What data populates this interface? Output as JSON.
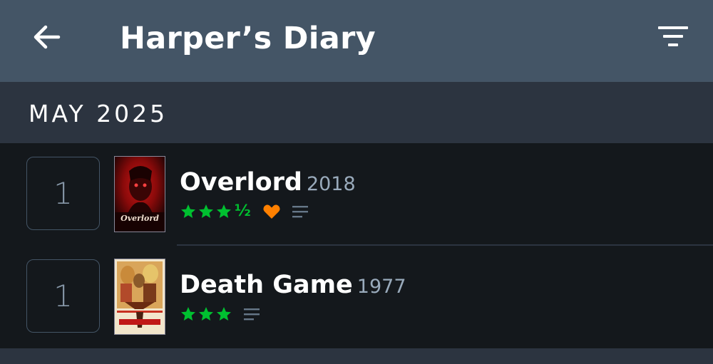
{
  "header": {
    "title": "Harper’s Diary",
    "back_icon": "arrow-left-icon",
    "filter_icon": "filter-icon"
  },
  "section": {
    "month": "MAY 2025"
  },
  "entries": [
    {
      "day": "1",
      "title": "Overlord",
      "year": "2018",
      "rating": 3.5,
      "rating_half": "½",
      "liked": true,
      "has_review": true,
      "poster_text": "Overlord"
    },
    {
      "day": "1",
      "title": "Death Game",
      "year": "1977",
      "rating": 3,
      "liked": false,
      "has_review": true
    }
  ],
  "colors": {
    "appbar": "#445566",
    "section": "#2c3440",
    "background": "#14181c",
    "star": "#00c030",
    "heart": "#ff8000",
    "year": "#99aabb"
  }
}
